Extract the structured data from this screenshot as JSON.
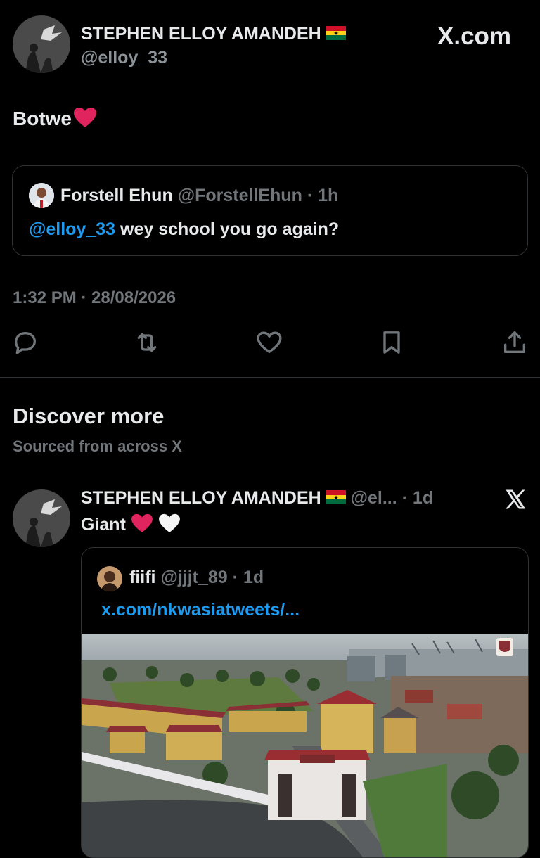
{
  "main_tweet": {
    "author_name": "STEPHEN ELLOY AMANDEH",
    "author_handle": "@elloy_33",
    "brand": "X.com",
    "text": "Botwe",
    "quoted": {
      "name": "Forstell Ehun",
      "handle": "@ForstellEhun",
      "time": "· 1h",
      "mention": "@elloy_33",
      "text": " wey school you go again?"
    },
    "timestamp": "1:32 PM · 28/08/2026"
  },
  "discover": {
    "title": "Discover more",
    "subtitle": "Sourced from across X"
  },
  "second_tweet": {
    "author_name": "STEPHEN ELLOY AMANDEH",
    "author_handle": "@el...",
    "time": "· 1d",
    "text": "Giant",
    "quoted": {
      "name": "fiifi",
      "handle": "@jjjt_89",
      "time": "· 1d",
      "link": "x.com/nkwasiatweets/..."
    }
  },
  "colors": {
    "background": "#000000",
    "link": "#1d9bf0",
    "muted": "#71767b",
    "border": "#2f3336",
    "heart_red": "#e0245e"
  },
  "icons": [
    "reply-icon",
    "retweet-icon",
    "like-icon",
    "bookmark-icon",
    "share-icon",
    "x-logo-icon",
    "red-heart-icon",
    "white-heart-icon",
    "ghana-flag-icon"
  ]
}
